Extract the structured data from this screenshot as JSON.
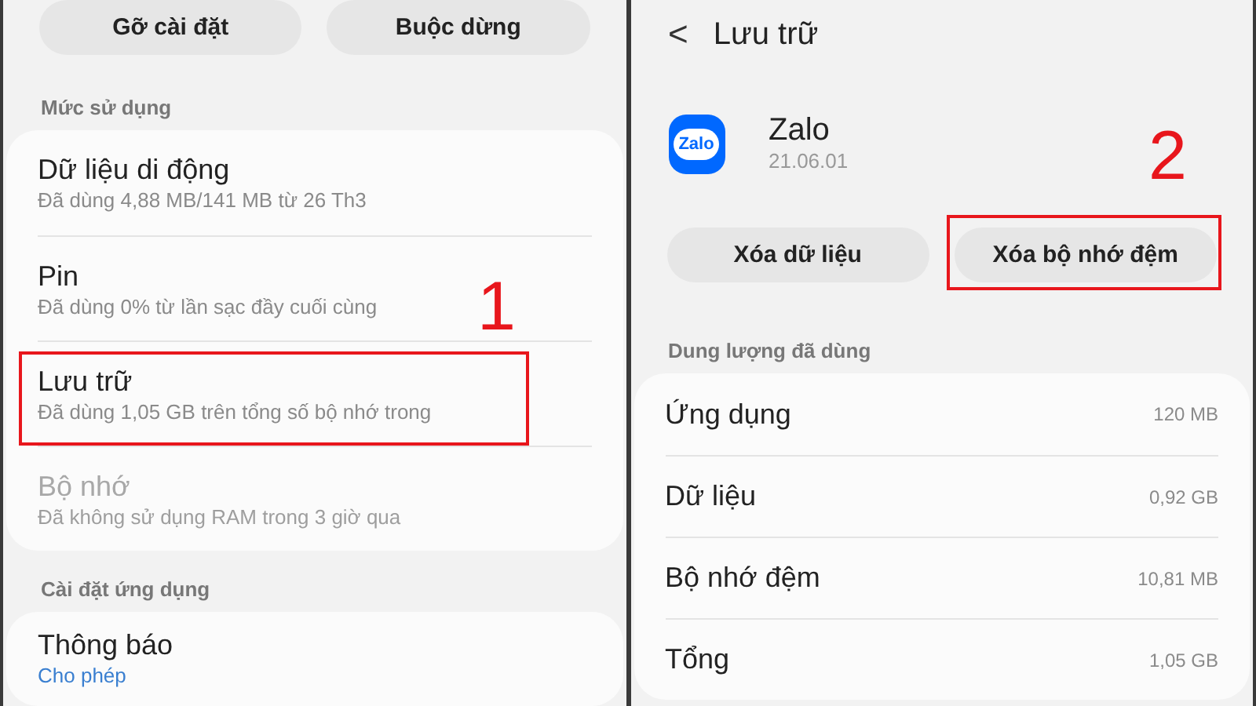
{
  "left_screen": {
    "buttons": [
      "Gỡ cài đặt",
      "Buộc dừng"
    ],
    "sections": [
      {
        "label": "Mức sử dụng",
        "items": [
          {
            "title": "Dữ liệu di động",
            "subtitle": "Đã dùng 4,88 MB/141 MB từ 26 Th3",
            "disabled": false,
            "highlighted": false
          },
          {
            "title": "Pin",
            "subtitle": "Đã dùng 0% từ lần sạc đầy cuối cùng",
            "disabled": false,
            "highlighted": false
          },
          {
            "title": "Lưu trữ",
            "subtitle": "Đã dùng 1,05 GB trên tổng số bộ nhớ trong",
            "disabled": false,
            "highlighted": true
          },
          {
            "title": "Bộ nhớ",
            "subtitle": "Đã không sử dụng RAM trong 3 giờ qua",
            "disabled": true,
            "highlighted": false
          }
        ]
      },
      {
        "label": "Cài đặt ứng dụng",
        "items": [
          {
            "title": "Thông báo",
            "subtitle": "Cho phép",
            "kind": "link",
            "disabled": false,
            "highlighted": false
          }
        ]
      }
    ],
    "step_number": "1"
  },
  "right_screen": {
    "header": {
      "back": "<",
      "title": "Lưu trữ"
    },
    "app": {
      "name": "Zalo",
      "version": "21.06.01",
      "icon_text": "Zalo"
    },
    "step_number": "2",
    "buttons": [
      {
        "label": "Xóa dữ liệu",
        "highlighted": false
      },
      {
        "label": "Xóa bộ nhớ đệm",
        "highlighted": true
      }
    ],
    "usage": {
      "label": "Dung lượng đã dùng",
      "rows": [
        {
          "name": "Ứng dụng",
          "value": "120 MB"
        },
        {
          "name": "Dữ liệu",
          "value": "0,92 GB"
        },
        {
          "name": "Bộ nhớ đệm",
          "value": "10,81 MB"
        },
        {
          "name": "Tổng",
          "value": "1,05 GB"
        }
      ]
    }
  }
}
